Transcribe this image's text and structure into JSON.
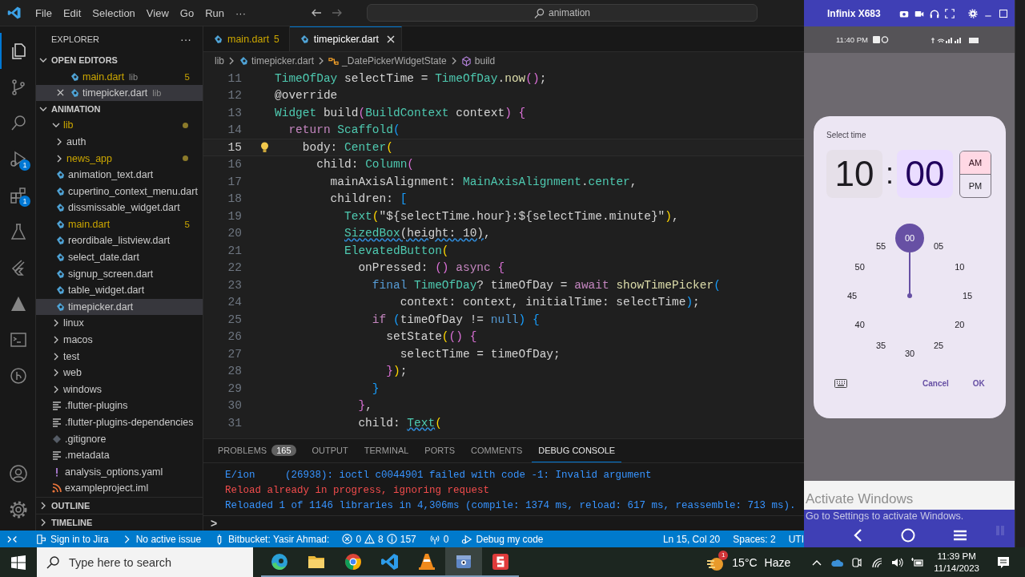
{
  "title_bar": {
    "menus": [
      "File",
      "Edit",
      "Selection",
      "View",
      "Go",
      "Run",
      "···"
    ],
    "search": "animation"
  },
  "activity_bar": {
    "top": [
      {
        "kind": "files",
        "selected": true
      },
      {
        "kind": "source-control",
        "selected": false
      },
      {
        "kind": "search",
        "selected": false
      },
      {
        "kind": "debug",
        "selected": false,
        "badge": "1"
      },
      {
        "kind": "extensions",
        "selected": false,
        "badge": "1"
      },
      {
        "kind": "flask",
        "selected": false
      },
      {
        "kind": "flutter",
        "selected": false
      },
      {
        "kind": "mountain",
        "selected": false
      },
      {
        "kind": "terminal",
        "selected": false
      },
      {
        "kind": "branch-circle",
        "selected": false
      }
    ],
    "bottom": [
      {
        "kind": "account",
        "selected": false
      },
      {
        "kind": "settings",
        "selected": false
      }
    ]
  },
  "explorer": {
    "title": "EXPLORER",
    "more": "···",
    "open_editors": {
      "title": "OPEN EDITORS",
      "expanded": true,
      "items": [
        {
          "name": "main.dart",
          "folder": "lib",
          "count": "5",
          "warning": true,
          "selected": false,
          "hovered": false
        },
        {
          "name": "timepicker.dart",
          "folder": "lib",
          "warning": false,
          "selected": true,
          "hovered": true
        }
      ]
    },
    "project": {
      "title": "ANIMATION",
      "expanded": true,
      "tree": [
        {
          "name": "lib",
          "kind": "folder",
          "expanded": true,
          "warning": true,
          "selected": false,
          "children": [
            {
              "name": "auth",
              "kind": "folder",
              "expanded": false,
              "warning": false,
              "selected": false
            },
            {
              "name": "news_app",
              "kind": "folder",
              "expanded": false,
              "warning": true,
              "selected": false
            },
            {
              "name": "animation_text.dart",
              "kind": "dart",
              "warning": false,
              "selected": false
            },
            {
              "name": "cupertino_context_menu.dart",
              "kind": "dart",
              "warning": false,
              "selected": false
            },
            {
              "name": "dissmissable_widget.dart",
              "kind": "dart",
              "warning": false,
              "selected": false
            },
            {
              "name": "main.dart",
              "kind": "dart",
              "warning": true,
              "count": "5",
              "selected": false
            },
            {
              "name": "reordibale_listview.dart",
              "kind": "dart",
              "warning": false,
              "selected": false
            },
            {
              "name": "select_date.dart",
              "kind": "dart",
              "warning": false,
              "selected": false
            },
            {
              "name": "signup_screen.dart",
              "kind": "dart",
              "warning": false,
              "selected": false
            },
            {
              "name": "table_widget.dart",
              "kind": "dart",
              "warning": false,
              "selected": false
            },
            {
              "name": "timepicker.dart",
              "kind": "dart",
              "warning": false,
              "selected": true
            }
          ]
        },
        {
          "name": "linux",
          "kind": "folder",
          "expanded": false,
          "warning": false,
          "selected": false
        },
        {
          "name": "macos",
          "kind": "folder",
          "expanded": false,
          "warning": false,
          "selected": false
        },
        {
          "name": "test",
          "kind": "folder",
          "expanded": false,
          "warning": false,
          "selected": false
        },
        {
          "name": "web",
          "kind": "folder",
          "expanded": false,
          "warning": false,
          "selected": false
        },
        {
          "name": "windows",
          "kind": "folder",
          "expanded": false,
          "warning": false,
          "selected": false
        },
        {
          "name": ".flutter-plugins",
          "kind": "lines",
          "warning": false,
          "selected": false
        },
        {
          "name": ".flutter-plugins-dependencies",
          "kind": "lines",
          "warning": false,
          "selected": false
        },
        {
          "name": ".gitignore",
          "kind": "git",
          "warning": false,
          "selected": false
        },
        {
          "name": ".metadata",
          "kind": "lines",
          "warning": false,
          "selected": false
        },
        {
          "name": "analysis_options.yaml",
          "kind": "yaml",
          "warning": false,
          "selected": false
        },
        {
          "name": "exampleproject.iml",
          "kind": "feed",
          "warning": false,
          "selected": false
        }
      ]
    },
    "sections": [
      {
        "title": "OUTLINE",
        "expanded": false
      },
      {
        "title": "TIMELINE",
        "expanded": false
      }
    ]
  },
  "editor": {
    "tabs": [
      {
        "name": "main.dart",
        "count": "5",
        "warning": true,
        "selected": false
      },
      {
        "name": "timepicker.dart",
        "warning": false,
        "selected": true
      }
    ],
    "breadcrumbs": [
      {
        "kind": "folder",
        "text": "lib"
      },
      {
        "kind": "dart",
        "text": "timepicker.dart"
      },
      {
        "kind": "class",
        "text": "_DatePickerWidgetState"
      },
      {
        "kind": "method",
        "text": "build"
      }
    ],
    "lines": [
      {
        "number": "11",
        "current": false,
        "lightbulb": false,
        "tokens": [
          {
            "kind": "type",
            "text": "TimeOfDay"
          },
          {
            "kind": "plain",
            "text": " selectTime = "
          },
          {
            "kind": "type",
            "text": "TimeOfDay"
          },
          {
            "kind": "plain",
            "text": "."
          },
          {
            "kind": "fn",
            "text": "now"
          },
          {
            "kind": "b1",
            "text": "()"
          },
          {
            "kind": "plain",
            "text": ";"
          }
        ]
      },
      {
        "number": "12",
        "current": false,
        "lightbulb": false,
        "tokens": [
          {
            "kind": "plain",
            "text": "@override"
          }
        ]
      },
      {
        "number": "13",
        "current": false,
        "lightbulb": false,
        "tokens": [
          {
            "kind": "type",
            "text": "Widget"
          },
          {
            "kind": "plain",
            "text": " build"
          },
          {
            "kind": "b1",
            "text": "("
          },
          {
            "kind": "type",
            "text": "BuildContext"
          },
          {
            "kind": "plain",
            "text": " context"
          },
          {
            "kind": "b1",
            "text": ") {"
          }
        ]
      },
      {
        "number": "14",
        "current": false,
        "lightbulb": false,
        "tokens": [
          {
            "kind": "kw",
            "text": "  return "
          },
          {
            "kind": "type",
            "text": "Scaffold"
          },
          {
            "kind": "b2",
            "text": "("
          }
        ]
      },
      {
        "number": "15",
        "current": true,
        "lightbulb": true,
        "tokens": [
          {
            "kind": "plain",
            "text": "    body: "
          },
          {
            "kind": "type",
            "text": "Center"
          },
          {
            "kind": "b3",
            "text": "("
          }
        ]
      },
      {
        "number": "16",
        "current": false,
        "lightbulb": false,
        "tokens": [
          {
            "kind": "plain",
            "text": "      child: "
          },
          {
            "kind": "type",
            "text": "Column"
          },
          {
            "kind": "b1",
            "text": "("
          }
        ]
      },
      {
        "number": "17",
        "current": false,
        "lightbulb": false,
        "tokens": [
          {
            "kind": "plain",
            "text": "        mainAxisAlignment: "
          },
          {
            "kind": "type",
            "text": "MainAxisAlignment"
          },
          {
            "kind": "plain",
            "text": "."
          },
          {
            "kind": "type",
            "text": "center"
          },
          {
            "kind": "plain",
            "text": ","
          }
        ]
      },
      {
        "number": "18",
        "current": false,
        "lightbulb": false,
        "tokens": [
          {
            "kind": "plain",
            "text": "        children: "
          },
          {
            "kind": "b2",
            "text": "["
          }
        ]
      },
      {
        "number": "19",
        "current": false,
        "lightbulb": false,
        "tokens": [
          {
            "kind": "type",
            "text": "          Text"
          },
          {
            "kind": "b3",
            "text": "("
          },
          {
            "kind": "plain",
            "text": "\"${selectTime.hour}:${selectTime.minute}\""
          },
          {
            "kind": "b3",
            "text": ")"
          },
          {
            "kind": "plain",
            "text": ","
          }
        ]
      },
      {
        "number": "20",
        "current": false,
        "lightbulb": false,
        "tokens": [
          {
            "kind": "type_warn",
            "text": "          SizedBox"
          },
          {
            "kind": "plain_warn",
            "text": "(height: 10)"
          },
          {
            "kind": "plain",
            "text": ","
          }
        ]
      },
      {
        "number": "21",
        "current": false,
        "lightbulb": false,
        "tokens": [
          {
            "kind": "type",
            "text": "          ElevatedButton"
          },
          {
            "kind": "b3",
            "text": "("
          }
        ]
      },
      {
        "number": "22",
        "current": false,
        "lightbulb": false,
        "tokens": [
          {
            "kind": "plain",
            "text": "            onPressed: "
          },
          {
            "kind": "b1",
            "text": "() "
          },
          {
            "kind": "kw",
            "text": "async "
          },
          {
            "kind": "b1",
            "text": "{"
          }
        ]
      },
      {
        "number": "23",
        "current": false,
        "lightbulb": false,
        "tokens": [
          {
            "kind": "kw2",
            "text": "              final "
          },
          {
            "kind": "type",
            "text": "TimeOfDay"
          },
          {
            "kind": "plain",
            "text": "? timeOfDay = "
          },
          {
            "kind": "kw",
            "text": "await "
          },
          {
            "kind": "fn",
            "text": "showTimePicker"
          },
          {
            "kind": "b2",
            "text": "("
          }
        ]
      },
      {
        "number": "24",
        "current": false,
        "lightbulb": false,
        "tokens": [
          {
            "kind": "plain",
            "text": "                  context: context, initialTime: selectTime"
          },
          {
            "kind": "b2",
            "text": ")"
          },
          {
            "kind": "plain",
            "text": ";"
          }
        ]
      },
      {
        "number": "25",
        "current": false,
        "lightbulb": false,
        "tokens": [
          {
            "kind": "kw",
            "text": "              if "
          },
          {
            "kind": "b2",
            "text": "("
          },
          {
            "kind": "plain",
            "text": "timeOfDay != "
          },
          {
            "kind": "kw2",
            "text": "null"
          },
          {
            "kind": "b2",
            "text": ") {"
          }
        ]
      },
      {
        "number": "26",
        "current": false,
        "lightbulb": false,
        "tokens": [
          {
            "kind": "plain",
            "text": "                setState"
          },
          {
            "kind": "b3",
            "text": "("
          },
          {
            "kind": "b1",
            "text": "() {"
          }
        ]
      },
      {
        "number": "27",
        "current": false,
        "lightbulb": false,
        "tokens": [
          {
            "kind": "plain",
            "text": "                  selectTime = timeOfDay;"
          }
        ]
      },
      {
        "number": "28",
        "current": false,
        "lightbulb": false,
        "tokens": [
          {
            "kind": "b1",
            "text": "                }"
          },
          {
            "kind": "b3",
            "text": ")"
          },
          {
            "kind": "plain",
            "text": ";"
          }
        ]
      },
      {
        "number": "29",
        "current": false,
        "lightbulb": false,
        "tokens": [
          {
            "kind": "b2",
            "text": "              }"
          }
        ]
      },
      {
        "number": "30",
        "current": false,
        "lightbulb": false,
        "tokens": [
          {
            "kind": "b1",
            "text": "            }"
          },
          {
            "kind": "plain",
            "text": ","
          }
        ]
      },
      {
        "number": "31",
        "current": false,
        "lightbulb": false,
        "tokens": [
          {
            "kind": "plain",
            "text": "            child: "
          },
          {
            "kind": "type_warn",
            "text": "Text"
          },
          {
            "kind": "b3",
            "text": "("
          }
        ]
      }
    ]
  },
  "panel": {
    "tabs": [
      {
        "label": "PROBLEMS",
        "badge": "165",
        "selected": false
      },
      {
        "label": "OUTPUT",
        "selected": false
      },
      {
        "label": "TERMINAL",
        "selected": false
      },
      {
        "label": "PORTS",
        "selected": false
      },
      {
        "label": "COMMENTS",
        "selected": false
      },
      {
        "label": "DEBUG CONSOLE",
        "selected": true
      }
    ],
    "lines": [
      {
        "kind": "info",
        "text": "E/ion     (26938): ioctl c0044901 failed with code -1: Invalid argument"
      },
      {
        "kind": "error",
        "text": "Reload already in progress, ignoring request"
      },
      {
        "kind": "info",
        "text": "Reloaded 1 of 1146 libraries in 4,306ms (compile: 1374 ms, reload: 617 ms, reassemble: 713 ms)."
      }
    ],
    "prompt": ">"
  },
  "status_bar": {
    "left": [
      {
        "kind": "remote"
      },
      {
        "kind": "jira",
        "text": "Sign in to Jira"
      },
      {
        "kind": "issue",
        "text": "No active issue"
      },
      {
        "kind": "bitbucket",
        "text": "Bitbucket: Yasir Ahmad:"
      },
      {
        "kind": "problems",
        "errors": "0",
        "warnings": "8",
        "infos": "157"
      },
      {
        "kind": "ports",
        "text": "0"
      },
      {
        "kind": "debug",
        "text": "Debug my code"
      }
    ],
    "right": [
      "Ln 15, Col 20",
      "Spaces: 2",
      "UTI"
    ]
  },
  "emulator": {
    "title": "Infinix X683",
    "phone_time": "11:40 PM",
    "dialog": {
      "title": "Select time",
      "hour": {
        "text": "10",
        "selected": false
      },
      "separator": ":",
      "minute": {
        "text": "00",
        "selected": true
      },
      "periods": [
        {
          "label": "AM",
          "selected": true
        },
        {
          "label": "PM",
          "selected": false
        }
      ],
      "dial": [
        {
          "label": "00",
          "selected": true
        },
        {
          "label": "05",
          "selected": false
        },
        {
          "label": "10",
          "selected": false
        },
        {
          "label": "15",
          "selected": false
        },
        {
          "label": "20",
          "selected": false
        },
        {
          "label": "25",
          "selected": false
        },
        {
          "label": "30",
          "selected": false
        },
        {
          "label": "35",
          "selected": false
        },
        {
          "label": "40",
          "selected": false
        },
        {
          "label": "45",
          "selected": false
        },
        {
          "label": "50",
          "selected": false
        },
        {
          "label": "55",
          "selected": false
        }
      ],
      "buttons": [
        "Cancel",
        "OK"
      ]
    }
  },
  "os_notice": {
    "title": "Activate Windows",
    "text": "Go to Settings to activate Windows."
  },
  "taskbar": {
    "search": "Type here to search",
    "apps": [
      {
        "kind": "edge",
        "selected": false
      },
      {
        "kind": "folder",
        "selected": false
      },
      {
        "kind": "chrome",
        "selected": false
      },
      {
        "kind": "vscode",
        "selected": false
      },
      {
        "kind": "cone",
        "selected": false
      },
      {
        "kind": "mirror",
        "selected": true
      },
      {
        "kind": "s-app",
        "selected": false
      }
    ],
    "weather": {
      "badge": "1",
      "temperature": "15°C",
      "condition": "Haze"
    },
    "time": "11:39 PM",
    "date": "11/14/2023"
  }
}
